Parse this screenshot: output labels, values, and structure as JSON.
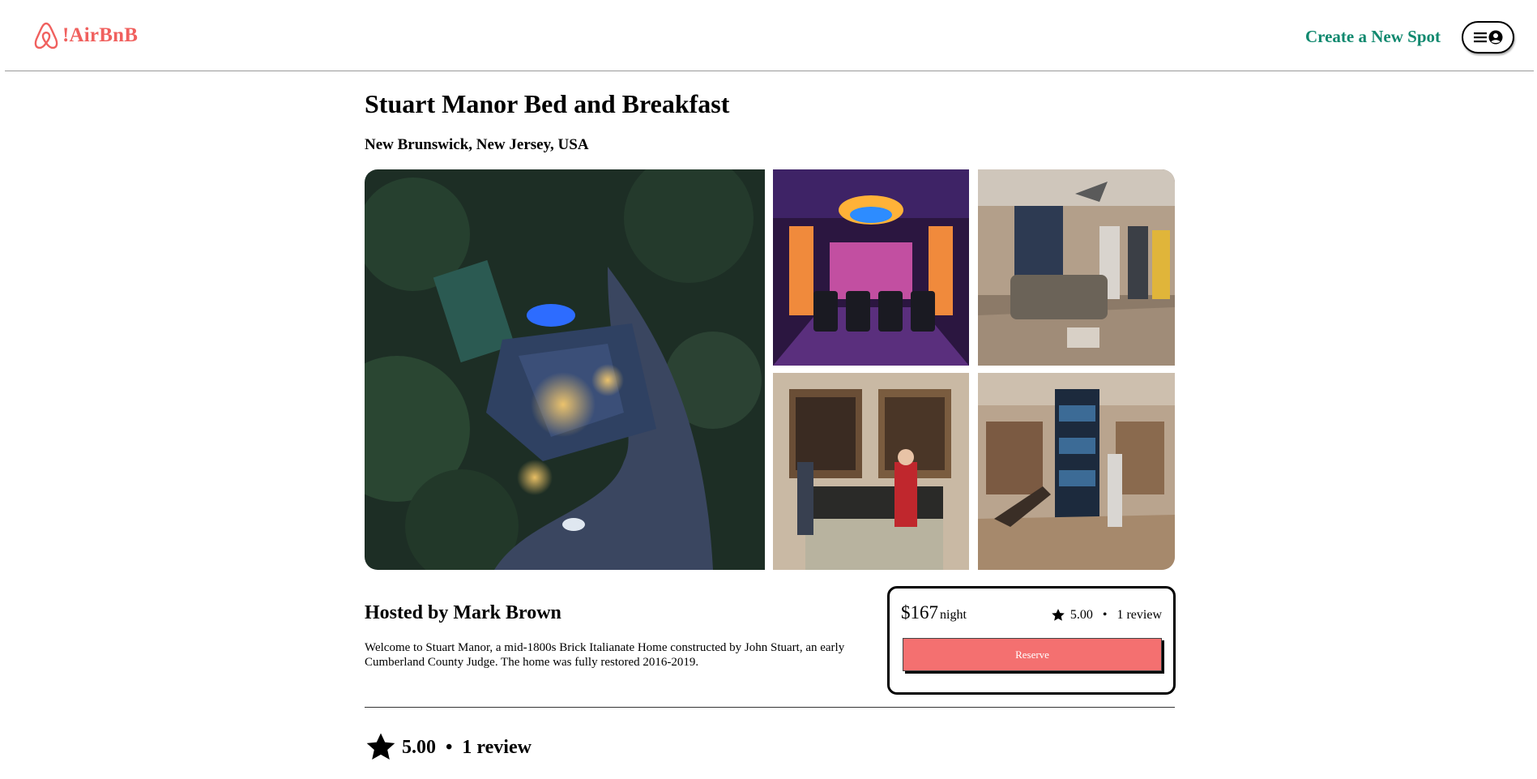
{
  "header": {
    "logo_text": "!AirBnB",
    "create_spot_label": "Create a New Spot",
    "menu_icon": "hamburger-icon",
    "profile_icon": "user-circle-icon"
  },
  "spot": {
    "name": "Stuart Manor Bed and Breakfast",
    "location": "New Brunswick, New Jersey, USA",
    "host_line": "Hosted by Mark Brown",
    "description": "Welcome to Stuart Manor, a mid-1800s Brick Italianate Home constructed by John Stuart, an early Cumberland County Judge. The home was fully restored 2016-2019."
  },
  "callout": {
    "price": "$167",
    "per": "night",
    "rating": "5.00",
    "reviews": "1 review",
    "reserve_label": "Reserve"
  },
  "reviews_summary": {
    "rating": "5.00",
    "reviews": "1 review"
  },
  "colors": {
    "brand": "#f0605e",
    "link": "#11896f",
    "reserve": "#f47070"
  }
}
